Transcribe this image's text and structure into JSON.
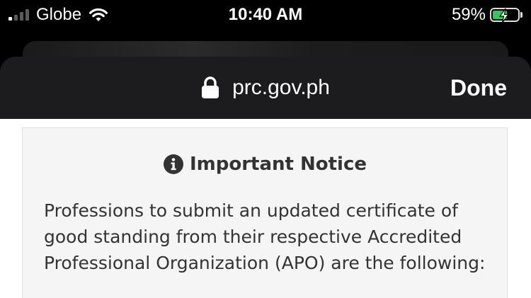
{
  "status_bar": {
    "carrier": "Globe",
    "time": "10:40 AM",
    "battery_percent": "59%",
    "signal_bars_active": 1,
    "signal_bars_total": 4,
    "battery_level": 0.59,
    "battery_color": "#34c759",
    "wifi_icon": "wifi-icon",
    "battery_icon": "battery-charging-icon"
  },
  "browser": {
    "url": "prc.gov.ph",
    "done_label": "Done",
    "lock_icon": "lock-icon"
  },
  "notice": {
    "title": "Important Notice",
    "icon": "info-icon",
    "text": "Professions to submit an updated certificate of good standing from their respective Accredited Professional Organization (APO) are the following:"
  }
}
